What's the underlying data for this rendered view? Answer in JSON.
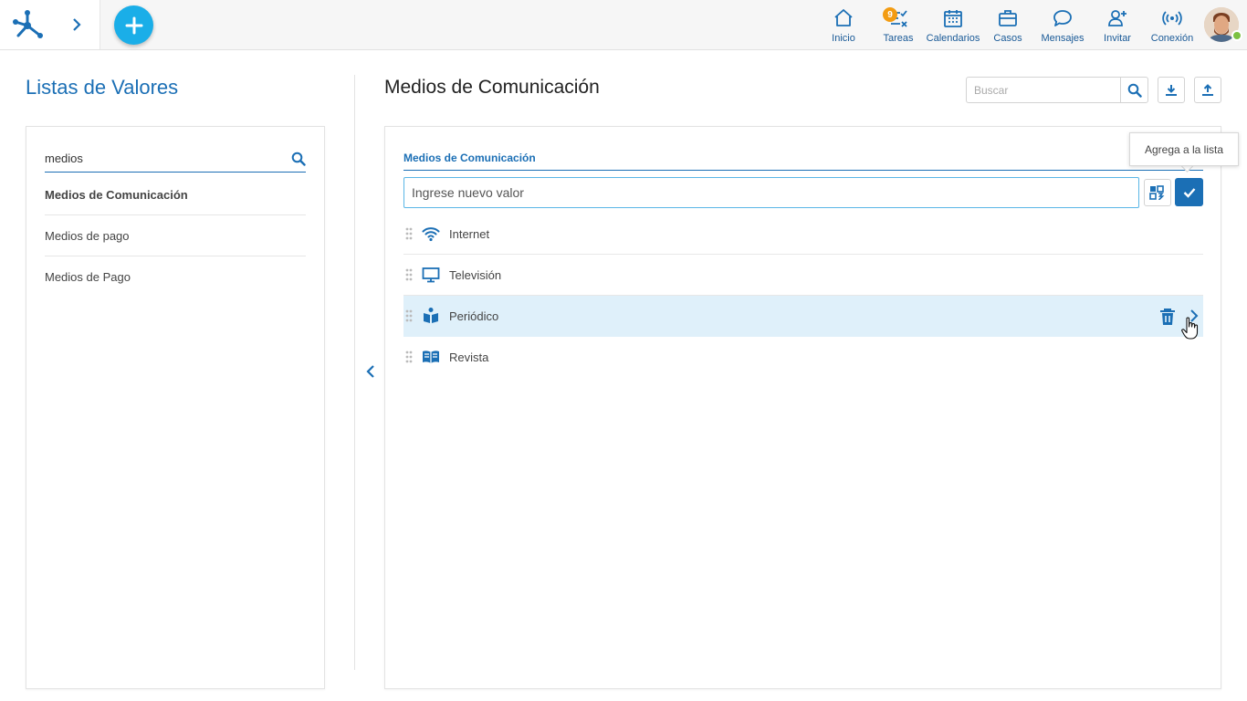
{
  "topbar": {
    "nav": [
      {
        "label": "Inicio",
        "icon": "home-icon"
      },
      {
        "label": "Tareas",
        "icon": "tasks-icon",
        "badge": "9"
      },
      {
        "label": "Calendarios",
        "icon": "calendar-icon"
      },
      {
        "label": "Casos",
        "icon": "briefcase-icon"
      },
      {
        "label": "Mensajes",
        "icon": "chat-icon"
      },
      {
        "label": "Invitar",
        "icon": "invite-icon"
      },
      {
        "label": "Conexión",
        "icon": "broadcast-icon"
      }
    ]
  },
  "sidebar": {
    "title": "Listas de Valores",
    "search_value": "medios",
    "items": [
      {
        "label": "Medios de Comunicación"
      },
      {
        "label": "Medios de pago"
      },
      {
        "label": "Medios de Pago"
      }
    ]
  },
  "main": {
    "title": "Medios de Comunicación",
    "search_placeholder": "Buscar",
    "list_label": "Medios de Comunicación",
    "input_placeholder": "Ingrese nuevo valor",
    "tooltip": "Agrega a la lista",
    "rows": [
      {
        "label": "Internet",
        "icon": "wifi-icon"
      },
      {
        "label": "Televisión",
        "icon": "monitor-icon"
      },
      {
        "label": "Periódico",
        "icon": "reader-icon"
      },
      {
        "label": "Revista",
        "icon": "open-book-icon"
      }
    ]
  },
  "colors": {
    "primary": "#1b6fb5",
    "accent": "#1aaee8",
    "badge": "#f39c12",
    "selected_row": "#dff0fa",
    "online": "#7cc142"
  }
}
